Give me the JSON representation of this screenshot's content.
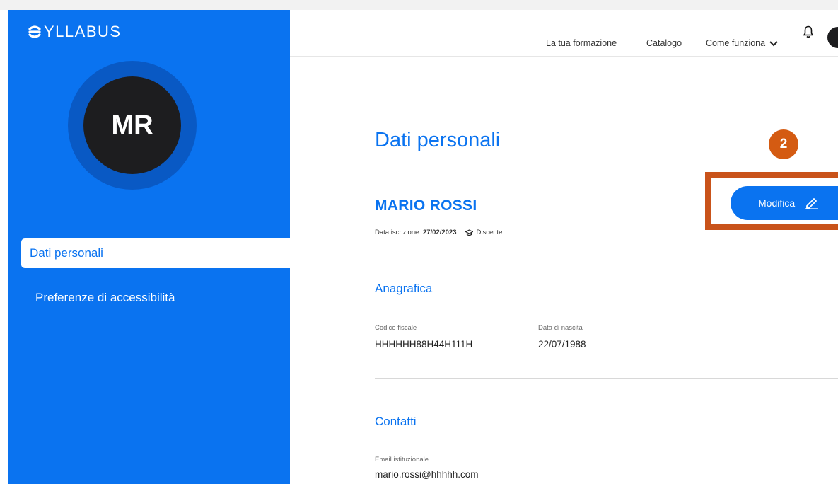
{
  "brand": {
    "logo_text": "YLLABUS"
  },
  "sidebar": {
    "avatar_initials": "MR",
    "items": [
      {
        "label": "Dati personali",
        "active": true
      },
      {
        "label": "Preferenze di accessibilità",
        "active": false
      }
    ]
  },
  "header": {
    "nav": [
      {
        "label": "La tua formazione"
      },
      {
        "label": "Catalogo"
      },
      {
        "label": "Come funziona"
      }
    ]
  },
  "main": {
    "title": "Dati personali",
    "step_badge": "2",
    "edit_button_label": "Modifica",
    "user": {
      "name": "MARIO ROSSI",
      "enrollment_label": "Data iscrizione:",
      "enrollment_date": "27/02/2023",
      "role": "Discente"
    },
    "anagrafica": {
      "title": "Anagrafica",
      "fields": [
        {
          "label": "Codice fiscale",
          "value": "HHHHHH88H44H111H"
        },
        {
          "label": "Data di nascita",
          "value": "22/07/1988"
        }
      ]
    },
    "contatti": {
      "title": "Contatti",
      "fields": [
        {
          "label": "Email istituzionale",
          "value": "mario.rossi@hhhhh.com"
        }
      ]
    }
  },
  "colors": {
    "primary": "#0a73f0",
    "sidebar": "#0a73f0",
    "avatar": "#1d1d1f",
    "highlight": "#c9531a",
    "badge": "#d45b12"
  },
  "icons": [
    "syllabus-logo-icon",
    "chevron-down-icon",
    "bell-icon",
    "pencil-icon",
    "graduation-cap-icon"
  ]
}
